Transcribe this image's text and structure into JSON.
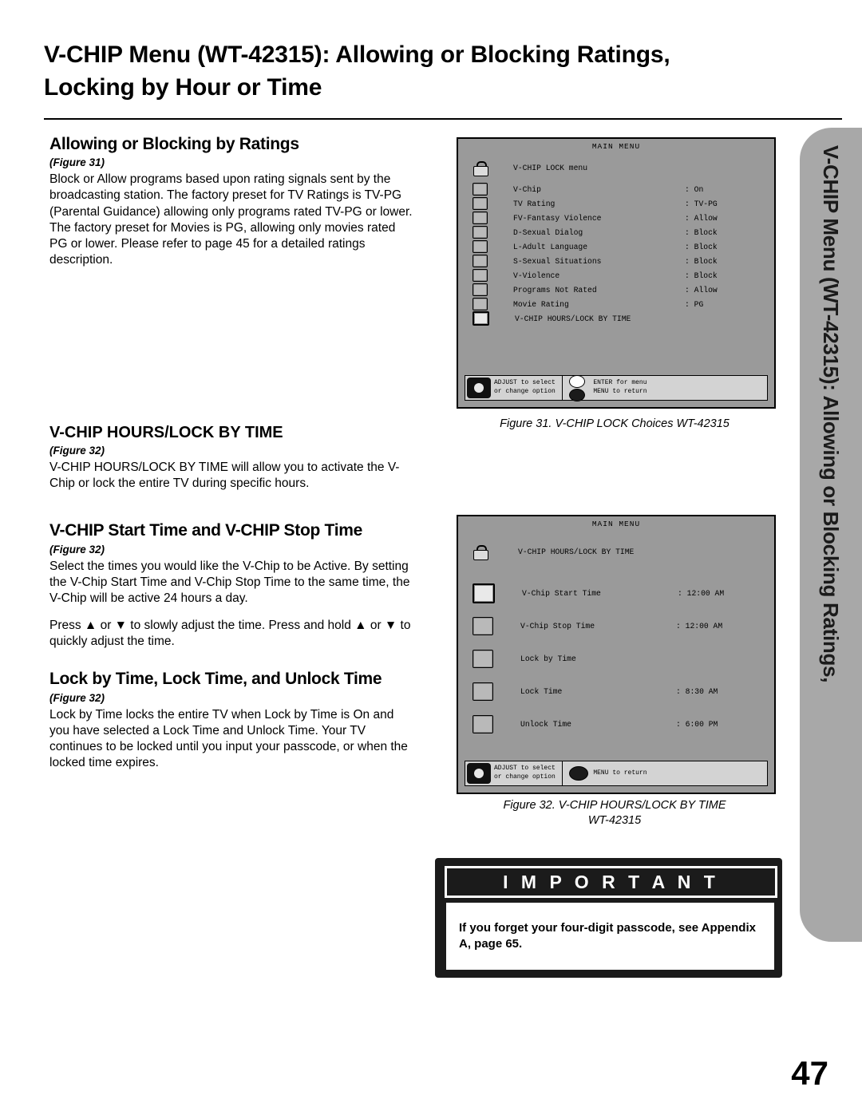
{
  "page": {
    "title": "V-CHIP Menu (WT-42315):  Allowing or Blocking Ratings, Locking by Hour or Time",
    "number": "47",
    "side_tab": "V-CHIP Menu (WT-42315):  Allowing or Blocking Ratings,"
  },
  "sections": [
    {
      "heading": "Allowing or Blocking  by Ratings",
      "figref": "(Figure 31)",
      "body": "Block or Allow programs based upon rating signals sent by the broadcasting station.  The factory preset for TV Ratings is TV-PG (Parental Guidance) allowing only programs rated TV-PG or lower.  The factory preset for Movies is PG, allowing only movies rated PG or lower.  Please refer to page 45 for a detailed ratings description."
    },
    {
      "heading": "V-CHIP HOURS/LOCK BY TIME",
      "figref": "(Figure 32)",
      "body": "V-CHIP HOURS/LOCK BY TIME will allow you to activate the V-Chip or lock the entire TV during specific hours."
    },
    {
      "heading": "V-CHIP Start Time and V-CHIP Stop Time",
      "figref": "(Figure 32)",
      "body": "Select the times you would like the V-Chip to be Active.  By setting the V-Chip Start Time and V-Chip Stop Time to the same time, the V-Chip will be active 24 hours a day.",
      "body2": "Press ▲ or  ▼ to slowly adjust the time.  Press and hold ▲ or ▼ to quickly adjust the time."
    },
    {
      "heading": "Lock by Time, Lock Time, and Unlock Time",
      "figref": "(Figure 32)",
      "body": "Lock by Time locks the entire TV when Lock by Time is On and you have selected a Lock Time and Unlock Time.  Your TV continues to be locked until you input your passcode, or when the locked time expires."
    }
  ],
  "figure31": {
    "menu_title": "MAIN MENU",
    "header_label": "V-CHIP LOCK menu",
    "rows": [
      {
        "label": "V-Chip",
        "value": ": On"
      },
      {
        "label": "TV Rating",
        "value": ": TV-PG"
      },
      {
        "label": "FV-Fantasy Violence",
        "value": ": Allow"
      },
      {
        "label": "D-Sexual Dialog",
        "value": ": Block"
      },
      {
        "label": "L-Adult Language",
        "value": ": Block"
      },
      {
        "label": "S-Sexual Situations",
        "value": ": Block"
      },
      {
        "label": "V-Violence",
        "value": ": Block"
      },
      {
        "label": "Programs Not Rated",
        "value": ": Allow"
      },
      {
        "label": "Movie Rating",
        "value": ": PG"
      },
      {
        "label": "V-CHIP HOURS/LOCK BY TIME",
        "value": ""
      }
    ],
    "footer_left_line1": "ADJUST to select",
    "footer_left_line2": "or change option",
    "footer_right_line1": "ENTER for menu",
    "footer_right_line2": "MENU to return",
    "caption": "Figure 31.  V-CHIP LOCK Choices WT-42315"
  },
  "figure32": {
    "menu_title": "MAIN MENU",
    "header_label": "V-CHIP HOURS/LOCK BY TIME",
    "rows": [
      {
        "label": "V-Chip Start Time",
        "value": ":  12:00 AM"
      },
      {
        "label": "V-Chip Stop Time",
        "value": ":  12:00 AM"
      },
      {
        "label": "Lock by Time",
        "value": ""
      },
      {
        "label": "Lock Time",
        "value": ":  8:30 AM"
      },
      {
        "label": "Unlock Time",
        "value": ":  6:00 PM"
      }
    ],
    "footer_left_line1": "ADJUST to select",
    "footer_left_line2": "or change option",
    "footer_right_line1": "MENU to return",
    "caption_line1": "Figure 32.  V-CHIP HOURS/LOCK BY TIME",
    "caption_line2": "WT-42315"
  },
  "important": {
    "banner": "I M P O R T A N T",
    "text": "If you forget your four-digit passcode, see Appendix A, page 65."
  }
}
